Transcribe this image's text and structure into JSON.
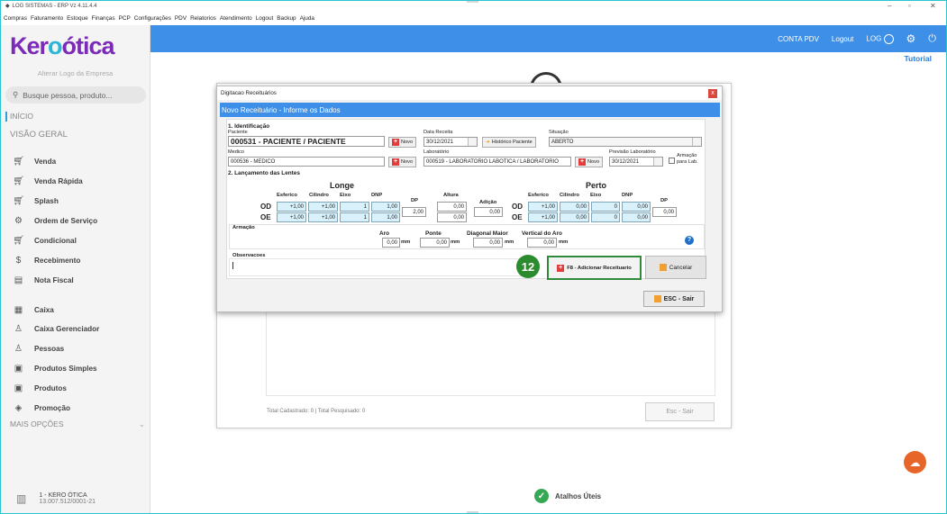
{
  "window": {
    "title": "LOG SISTEMAS - ERP Vz 4.11.4.4"
  },
  "menu": [
    "Compras",
    "Faturamento",
    "Estoque",
    "Finanças",
    "PCP",
    "Configurações",
    "PDV",
    "Relatorios",
    "Atendimento",
    "Logout",
    "Backup",
    "Ajuda"
  ],
  "brand": {
    "logo_part1": "Ker",
    "logo_part2": "o",
    "logo_part3": "ótica",
    "alt_logo": "Alterar Logo da Empresa"
  },
  "search": {
    "placeholder": "Busque pessoa, produto..."
  },
  "sidebar": {
    "inicio": "INÍCIO",
    "visao_geral": "VISÃO GERAL",
    "items": [
      {
        "label": "Venda"
      },
      {
        "label": "Venda Rápida"
      },
      {
        "label": "Splash"
      },
      {
        "label": "Ordem de Serviço"
      },
      {
        "label": "Condicional"
      },
      {
        "label": "Recebimento"
      },
      {
        "label": "Nota Fiscal"
      },
      {
        "label": "Caixa"
      },
      {
        "label": "Caixa Gerenciador"
      },
      {
        "label": "Pessoas"
      },
      {
        "label": "Produtos Simples"
      },
      {
        "label": "Produtos"
      },
      {
        "label": "Promoção"
      }
    ],
    "mais_opcoes": "MAIS OPÇÕES",
    "company_name": "1 - KERO ÓTICA",
    "company_cnpj": "13.007.512/0001-21"
  },
  "topbar": {
    "conta_pdv": "CONTA PDV",
    "logout": "Logout",
    "user": "LOG",
    "tutorial": "Tutorial"
  },
  "background_window": {
    "status": "Total Cadastrado: 0 | Total Pesquisado: 0",
    "esc_sair": "Esc - Sair"
  },
  "dialog": {
    "title": "Digitacao Receituários",
    "header": "Novo Receituário - Informe os Dados",
    "section1": "1. Identificação",
    "paciente_label": "Paciente",
    "paciente_value": "000531 - PACIENTE / PACIENTE",
    "novo": "Novo",
    "data_receita_label": "Data Receita",
    "data_receita_value": "30/12/2021",
    "historico_btn": "Histórico Paciente",
    "situacao_label": "Situação",
    "situacao_value": "ABERTO",
    "medico_label": "Medico",
    "medico_value": "000536 - MEDICO",
    "laboratorio_label": "Laboratório",
    "laboratorio_value": "000519 - LABORATORIO LABOTICA / LABORATORIO",
    "previsao_label": "Previsão Laboratório",
    "previsao_value": "30/12/2021",
    "armacao_lab_line1": "Armação",
    "armacao_lab_line2": "para Lab.",
    "section2": "2. Lançamento das Lentes",
    "longe": "Longe",
    "perto": "Perto",
    "col_esferico": "Esferico",
    "col_cilindro": "Cilindro",
    "col_eixo": "Eixo",
    "col_dnp": "DNP",
    "col_dp": "DP",
    "col_altura": "Altura",
    "col_adicao": "Adição",
    "od": "OD",
    "oe": "OE",
    "longe_od": {
      "esferico": "+1,00",
      "cilindro": "+1,00",
      "eixo": "1",
      "dnp": "1,00",
      "altura": "0,00"
    },
    "longe_oe": {
      "esferico": "+1,00",
      "cilindro": "+1,00",
      "eixo": "1",
      "dnp": "1,00",
      "altura": "0,00"
    },
    "longe_dp": "2,00",
    "adicao": "0,00",
    "perto_od": {
      "esferico": "+1,00",
      "cilindro": "0,00",
      "eixo": "0",
      "dnp": "0,00"
    },
    "perto_oe": {
      "esferico": "+1,00",
      "cilindro": "0,00",
      "eixo": "0",
      "dnp": "0,00"
    },
    "perto_dp": "0,00",
    "armacao_label": "Armação",
    "aro_label": "Aro",
    "aro_value": "0,00",
    "ponte_label": "Ponte",
    "ponte_value": "0,00",
    "diagonal_label": "Diagonal Maior",
    "diagonal_value": "0,00",
    "vertical_label": "Vertical do Aro",
    "vertical_value": "0,00",
    "mm": "mm",
    "observacoes_label": "Observacoes",
    "add_btn": "F8 - Adicionar Receituario",
    "cancel_btn": "Cancelar",
    "esc_btn": "ESC - Sair",
    "step_badge": "12"
  },
  "footer": {
    "atalhos": "Atalhos Úteis"
  }
}
